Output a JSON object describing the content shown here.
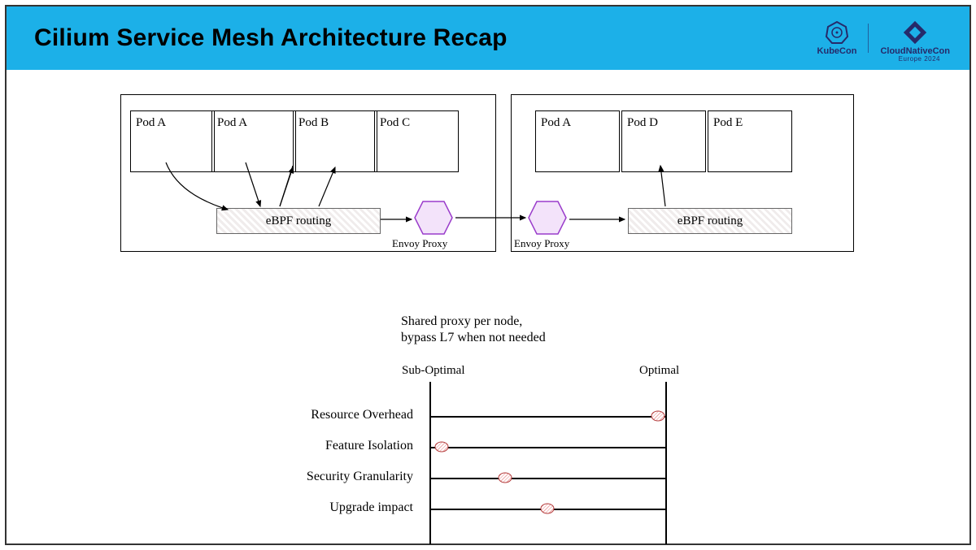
{
  "header": {
    "title": "Cilium Service Mesh Architecture Recap",
    "logos": {
      "left_name": "KubeCon",
      "right_name": "CloudNativeCon",
      "subline": "Europe 2024"
    }
  },
  "diagram": {
    "node_left": {
      "pods": [
        "Pod A",
        "Pod A",
        "Pod B",
        "Pod C"
      ],
      "ebpf_label": "eBPF routing",
      "proxy_label": "Envoy Proxy"
    },
    "node_right": {
      "pods": [
        "Pod A",
        "Pod D",
        "Pod E"
      ],
      "ebpf_label": "eBPF routing",
      "proxy_label": "Envoy Proxy"
    }
  },
  "chart_data": {
    "type": "bar",
    "title": "Shared proxy per node,\nbypass L7 when not needed",
    "xlabel": "",
    "ylabel": "",
    "axis_label_low": "Sub-Optimal",
    "axis_label_high": "Optimal",
    "categories": [
      "Resource Overhead",
      "Feature Isolation",
      "Security Granularity",
      "Upgrade impact"
    ],
    "values": [
      0.97,
      0.05,
      0.32,
      0.5
    ],
    "ylim": [
      0,
      1
    ]
  }
}
